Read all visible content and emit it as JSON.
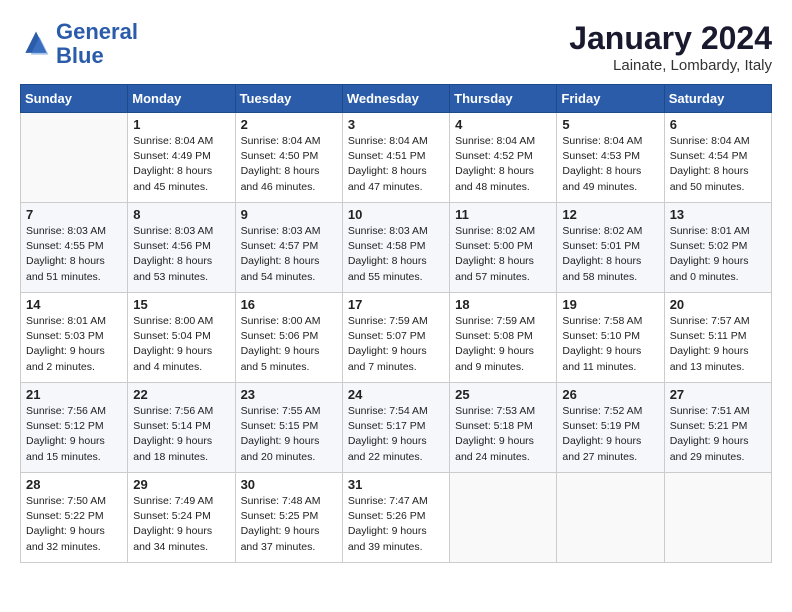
{
  "header": {
    "logo_line1": "General",
    "logo_line2": "Blue",
    "month": "January 2024",
    "location": "Lainate, Lombardy, Italy"
  },
  "weekdays": [
    "Sunday",
    "Monday",
    "Tuesday",
    "Wednesday",
    "Thursday",
    "Friday",
    "Saturday"
  ],
  "weeks": [
    [
      {
        "day": null,
        "sunrise": null,
        "sunset": null,
        "daylight": null
      },
      {
        "day": "1",
        "sunrise": "Sunrise: 8:04 AM",
        "sunset": "Sunset: 4:49 PM",
        "daylight": "Daylight: 8 hours and 45 minutes."
      },
      {
        "day": "2",
        "sunrise": "Sunrise: 8:04 AM",
        "sunset": "Sunset: 4:50 PM",
        "daylight": "Daylight: 8 hours and 46 minutes."
      },
      {
        "day": "3",
        "sunrise": "Sunrise: 8:04 AM",
        "sunset": "Sunset: 4:51 PM",
        "daylight": "Daylight: 8 hours and 47 minutes."
      },
      {
        "day": "4",
        "sunrise": "Sunrise: 8:04 AM",
        "sunset": "Sunset: 4:52 PM",
        "daylight": "Daylight: 8 hours and 48 minutes."
      },
      {
        "day": "5",
        "sunrise": "Sunrise: 8:04 AM",
        "sunset": "Sunset: 4:53 PM",
        "daylight": "Daylight: 8 hours and 49 minutes."
      },
      {
        "day": "6",
        "sunrise": "Sunrise: 8:04 AM",
        "sunset": "Sunset: 4:54 PM",
        "daylight": "Daylight: 8 hours and 50 minutes."
      }
    ],
    [
      {
        "day": "7",
        "sunrise": "Sunrise: 8:03 AM",
        "sunset": "Sunset: 4:55 PM",
        "daylight": "Daylight: 8 hours and 51 minutes."
      },
      {
        "day": "8",
        "sunrise": "Sunrise: 8:03 AM",
        "sunset": "Sunset: 4:56 PM",
        "daylight": "Daylight: 8 hours and 53 minutes."
      },
      {
        "day": "9",
        "sunrise": "Sunrise: 8:03 AM",
        "sunset": "Sunset: 4:57 PM",
        "daylight": "Daylight: 8 hours and 54 minutes."
      },
      {
        "day": "10",
        "sunrise": "Sunrise: 8:03 AM",
        "sunset": "Sunset: 4:58 PM",
        "daylight": "Daylight: 8 hours and 55 minutes."
      },
      {
        "day": "11",
        "sunrise": "Sunrise: 8:02 AM",
        "sunset": "Sunset: 5:00 PM",
        "daylight": "Daylight: 8 hours and 57 minutes."
      },
      {
        "day": "12",
        "sunrise": "Sunrise: 8:02 AM",
        "sunset": "Sunset: 5:01 PM",
        "daylight": "Daylight: 8 hours and 58 minutes."
      },
      {
        "day": "13",
        "sunrise": "Sunrise: 8:01 AM",
        "sunset": "Sunset: 5:02 PM",
        "daylight": "Daylight: 9 hours and 0 minutes."
      }
    ],
    [
      {
        "day": "14",
        "sunrise": "Sunrise: 8:01 AM",
        "sunset": "Sunset: 5:03 PM",
        "daylight": "Daylight: 9 hours and 2 minutes."
      },
      {
        "day": "15",
        "sunrise": "Sunrise: 8:00 AM",
        "sunset": "Sunset: 5:04 PM",
        "daylight": "Daylight: 9 hours and 4 minutes."
      },
      {
        "day": "16",
        "sunrise": "Sunrise: 8:00 AM",
        "sunset": "Sunset: 5:06 PM",
        "daylight": "Daylight: 9 hours and 5 minutes."
      },
      {
        "day": "17",
        "sunrise": "Sunrise: 7:59 AM",
        "sunset": "Sunset: 5:07 PM",
        "daylight": "Daylight: 9 hours and 7 minutes."
      },
      {
        "day": "18",
        "sunrise": "Sunrise: 7:59 AM",
        "sunset": "Sunset: 5:08 PM",
        "daylight": "Daylight: 9 hours and 9 minutes."
      },
      {
        "day": "19",
        "sunrise": "Sunrise: 7:58 AM",
        "sunset": "Sunset: 5:10 PM",
        "daylight": "Daylight: 9 hours and 11 minutes."
      },
      {
        "day": "20",
        "sunrise": "Sunrise: 7:57 AM",
        "sunset": "Sunset: 5:11 PM",
        "daylight": "Daylight: 9 hours and 13 minutes."
      }
    ],
    [
      {
        "day": "21",
        "sunrise": "Sunrise: 7:56 AM",
        "sunset": "Sunset: 5:12 PM",
        "daylight": "Daylight: 9 hours and 15 minutes."
      },
      {
        "day": "22",
        "sunrise": "Sunrise: 7:56 AM",
        "sunset": "Sunset: 5:14 PM",
        "daylight": "Daylight: 9 hours and 18 minutes."
      },
      {
        "day": "23",
        "sunrise": "Sunrise: 7:55 AM",
        "sunset": "Sunset: 5:15 PM",
        "daylight": "Daylight: 9 hours and 20 minutes."
      },
      {
        "day": "24",
        "sunrise": "Sunrise: 7:54 AM",
        "sunset": "Sunset: 5:17 PM",
        "daylight": "Daylight: 9 hours and 22 minutes."
      },
      {
        "day": "25",
        "sunrise": "Sunrise: 7:53 AM",
        "sunset": "Sunset: 5:18 PM",
        "daylight": "Daylight: 9 hours and 24 minutes."
      },
      {
        "day": "26",
        "sunrise": "Sunrise: 7:52 AM",
        "sunset": "Sunset: 5:19 PM",
        "daylight": "Daylight: 9 hours and 27 minutes."
      },
      {
        "day": "27",
        "sunrise": "Sunrise: 7:51 AM",
        "sunset": "Sunset: 5:21 PM",
        "daylight": "Daylight: 9 hours and 29 minutes."
      }
    ],
    [
      {
        "day": "28",
        "sunrise": "Sunrise: 7:50 AM",
        "sunset": "Sunset: 5:22 PM",
        "daylight": "Daylight: 9 hours and 32 minutes."
      },
      {
        "day": "29",
        "sunrise": "Sunrise: 7:49 AM",
        "sunset": "Sunset: 5:24 PM",
        "daylight": "Daylight: 9 hours and 34 minutes."
      },
      {
        "day": "30",
        "sunrise": "Sunrise: 7:48 AM",
        "sunset": "Sunset: 5:25 PM",
        "daylight": "Daylight: 9 hours and 37 minutes."
      },
      {
        "day": "31",
        "sunrise": "Sunrise: 7:47 AM",
        "sunset": "Sunset: 5:26 PM",
        "daylight": "Daylight: 9 hours and 39 minutes."
      },
      {
        "day": null,
        "sunrise": null,
        "sunset": null,
        "daylight": null
      },
      {
        "day": null,
        "sunrise": null,
        "sunset": null,
        "daylight": null
      },
      {
        "day": null,
        "sunrise": null,
        "sunset": null,
        "daylight": null
      }
    ]
  ]
}
